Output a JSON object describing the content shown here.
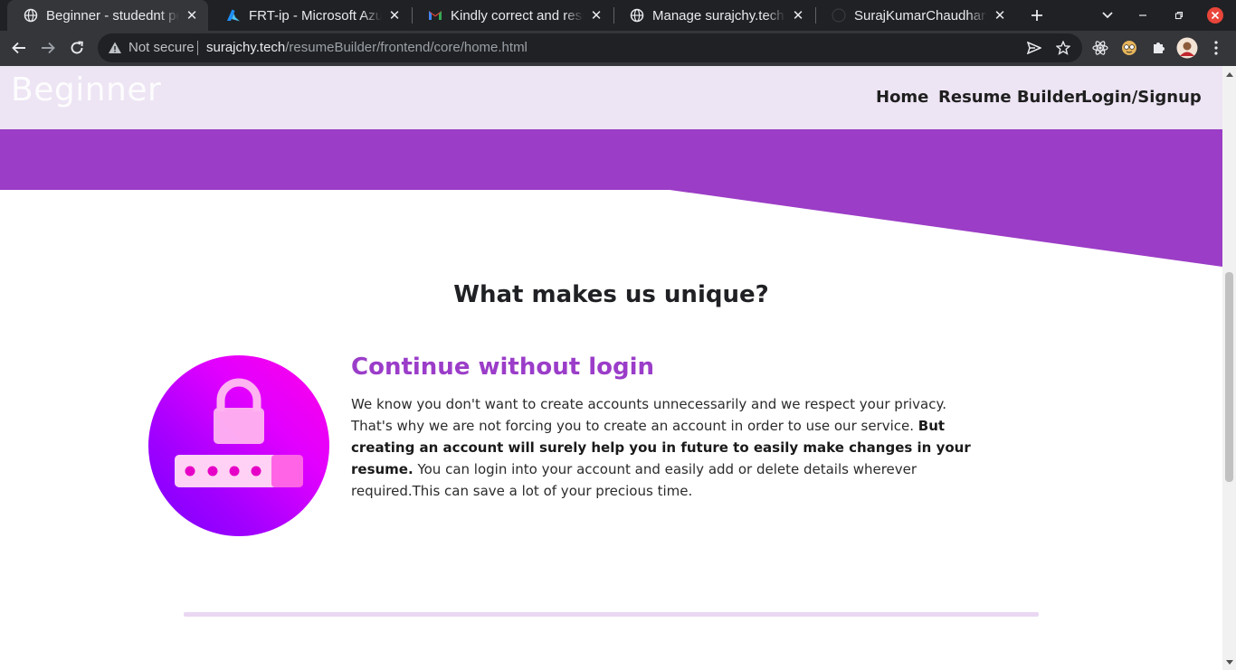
{
  "browser": {
    "tabs": [
      {
        "title": "Beginner - studednt po",
        "favicon": "globe-icon",
        "active": true
      },
      {
        "title": "FRT-ip - Microsoft Azure",
        "favicon": "azure-icon",
        "active": false
      },
      {
        "title": "Kindly correct and resu",
        "favicon": "gmail-icon",
        "active": false
      },
      {
        "title": "Manage surajchy.tech",
        "favicon": "globe-icon",
        "active": false
      },
      {
        "title": "SurajKumarChaudhary/",
        "favicon": "github-icon",
        "active": false
      }
    ],
    "security_label": "Not secure",
    "url_host": "surajchy.tech",
    "url_path": "/resumeBuilder/frontend/core/home.html"
  },
  "page": {
    "brand": "Beginner",
    "nav": {
      "home": "Home",
      "resume_builder": "Resume Builder",
      "login_signup": "Login/Signup"
    },
    "section_title": "What makes us unique?",
    "feature": {
      "heading": "Continue without login",
      "text_part1": "We know you don't want to create accounts unnecessarily and we respect your privacy. That's why we are not forcing you to create an account in order to use our service. ",
      "text_bold": "But creating an account will surely help you in future to easily make changes in your resume.",
      "text_part2": " You can login into your account and easily add or delete details wherever required.This can save  a lot of your precious time.",
      "image": "lock-password-icon"
    }
  },
  "colors": {
    "accent_purple": "#9b3dc9",
    "navbar_bg": "#ede4f4",
    "divider": "#ead7f3"
  }
}
